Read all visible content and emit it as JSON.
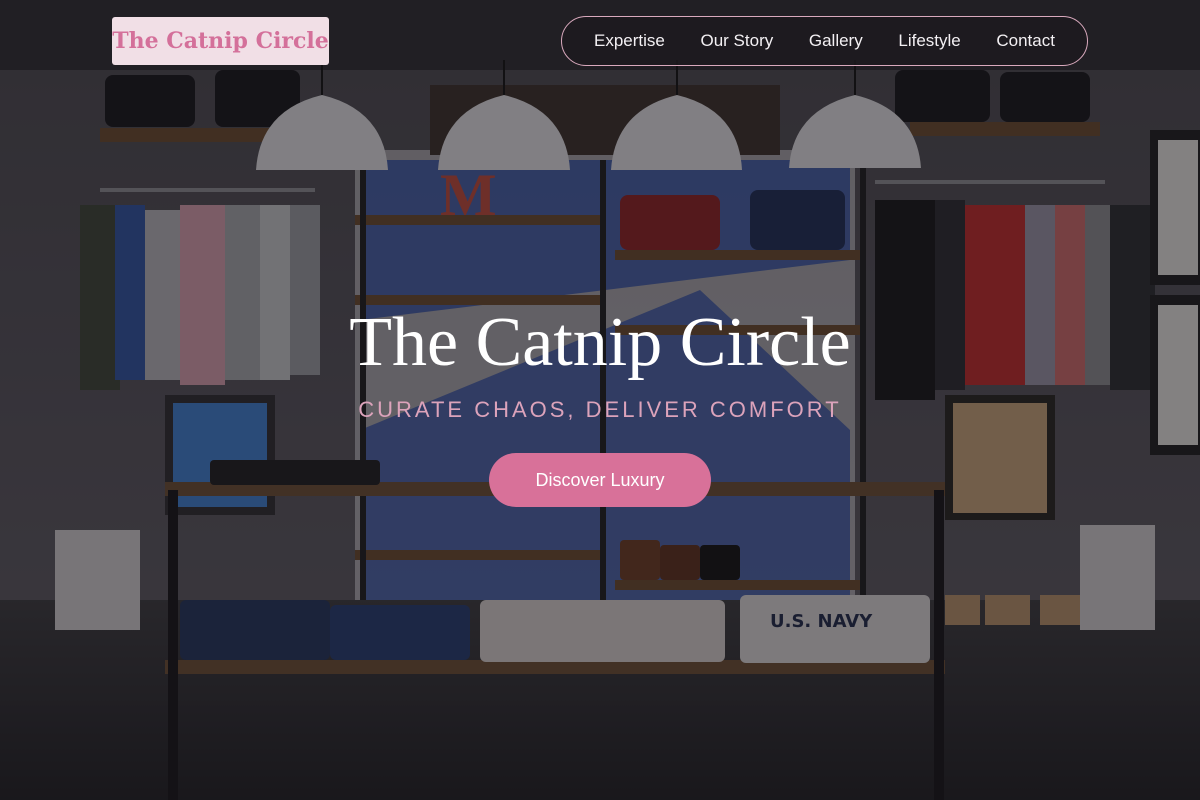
{
  "brand": {
    "logo_text": "The Catnip Circle"
  },
  "nav": {
    "items": [
      {
        "label": "Expertise"
      },
      {
        "label": "Our Story"
      },
      {
        "label": "Gallery"
      },
      {
        "label": "Lifestyle"
      },
      {
        "label": "Contact"
      }
    ]
  },
  "hero": {
    "title": "The Catnip Circle",
    "tagline": "CURATE CHAOS, DELIVER COMFORT",
    "cta_label": "Discover Luxury"
  },
  "background": {
    "visible_sign_text": "U.S. NAVY"
  },
  "colors": {
    "accent": "#d87199",
    "logo_bg": "#f1dfe6",
    "logo_text": "#d4709a",
    "tagline": "#dca3bb",
    "nav_border": "#d9a9bd"
  }
}
